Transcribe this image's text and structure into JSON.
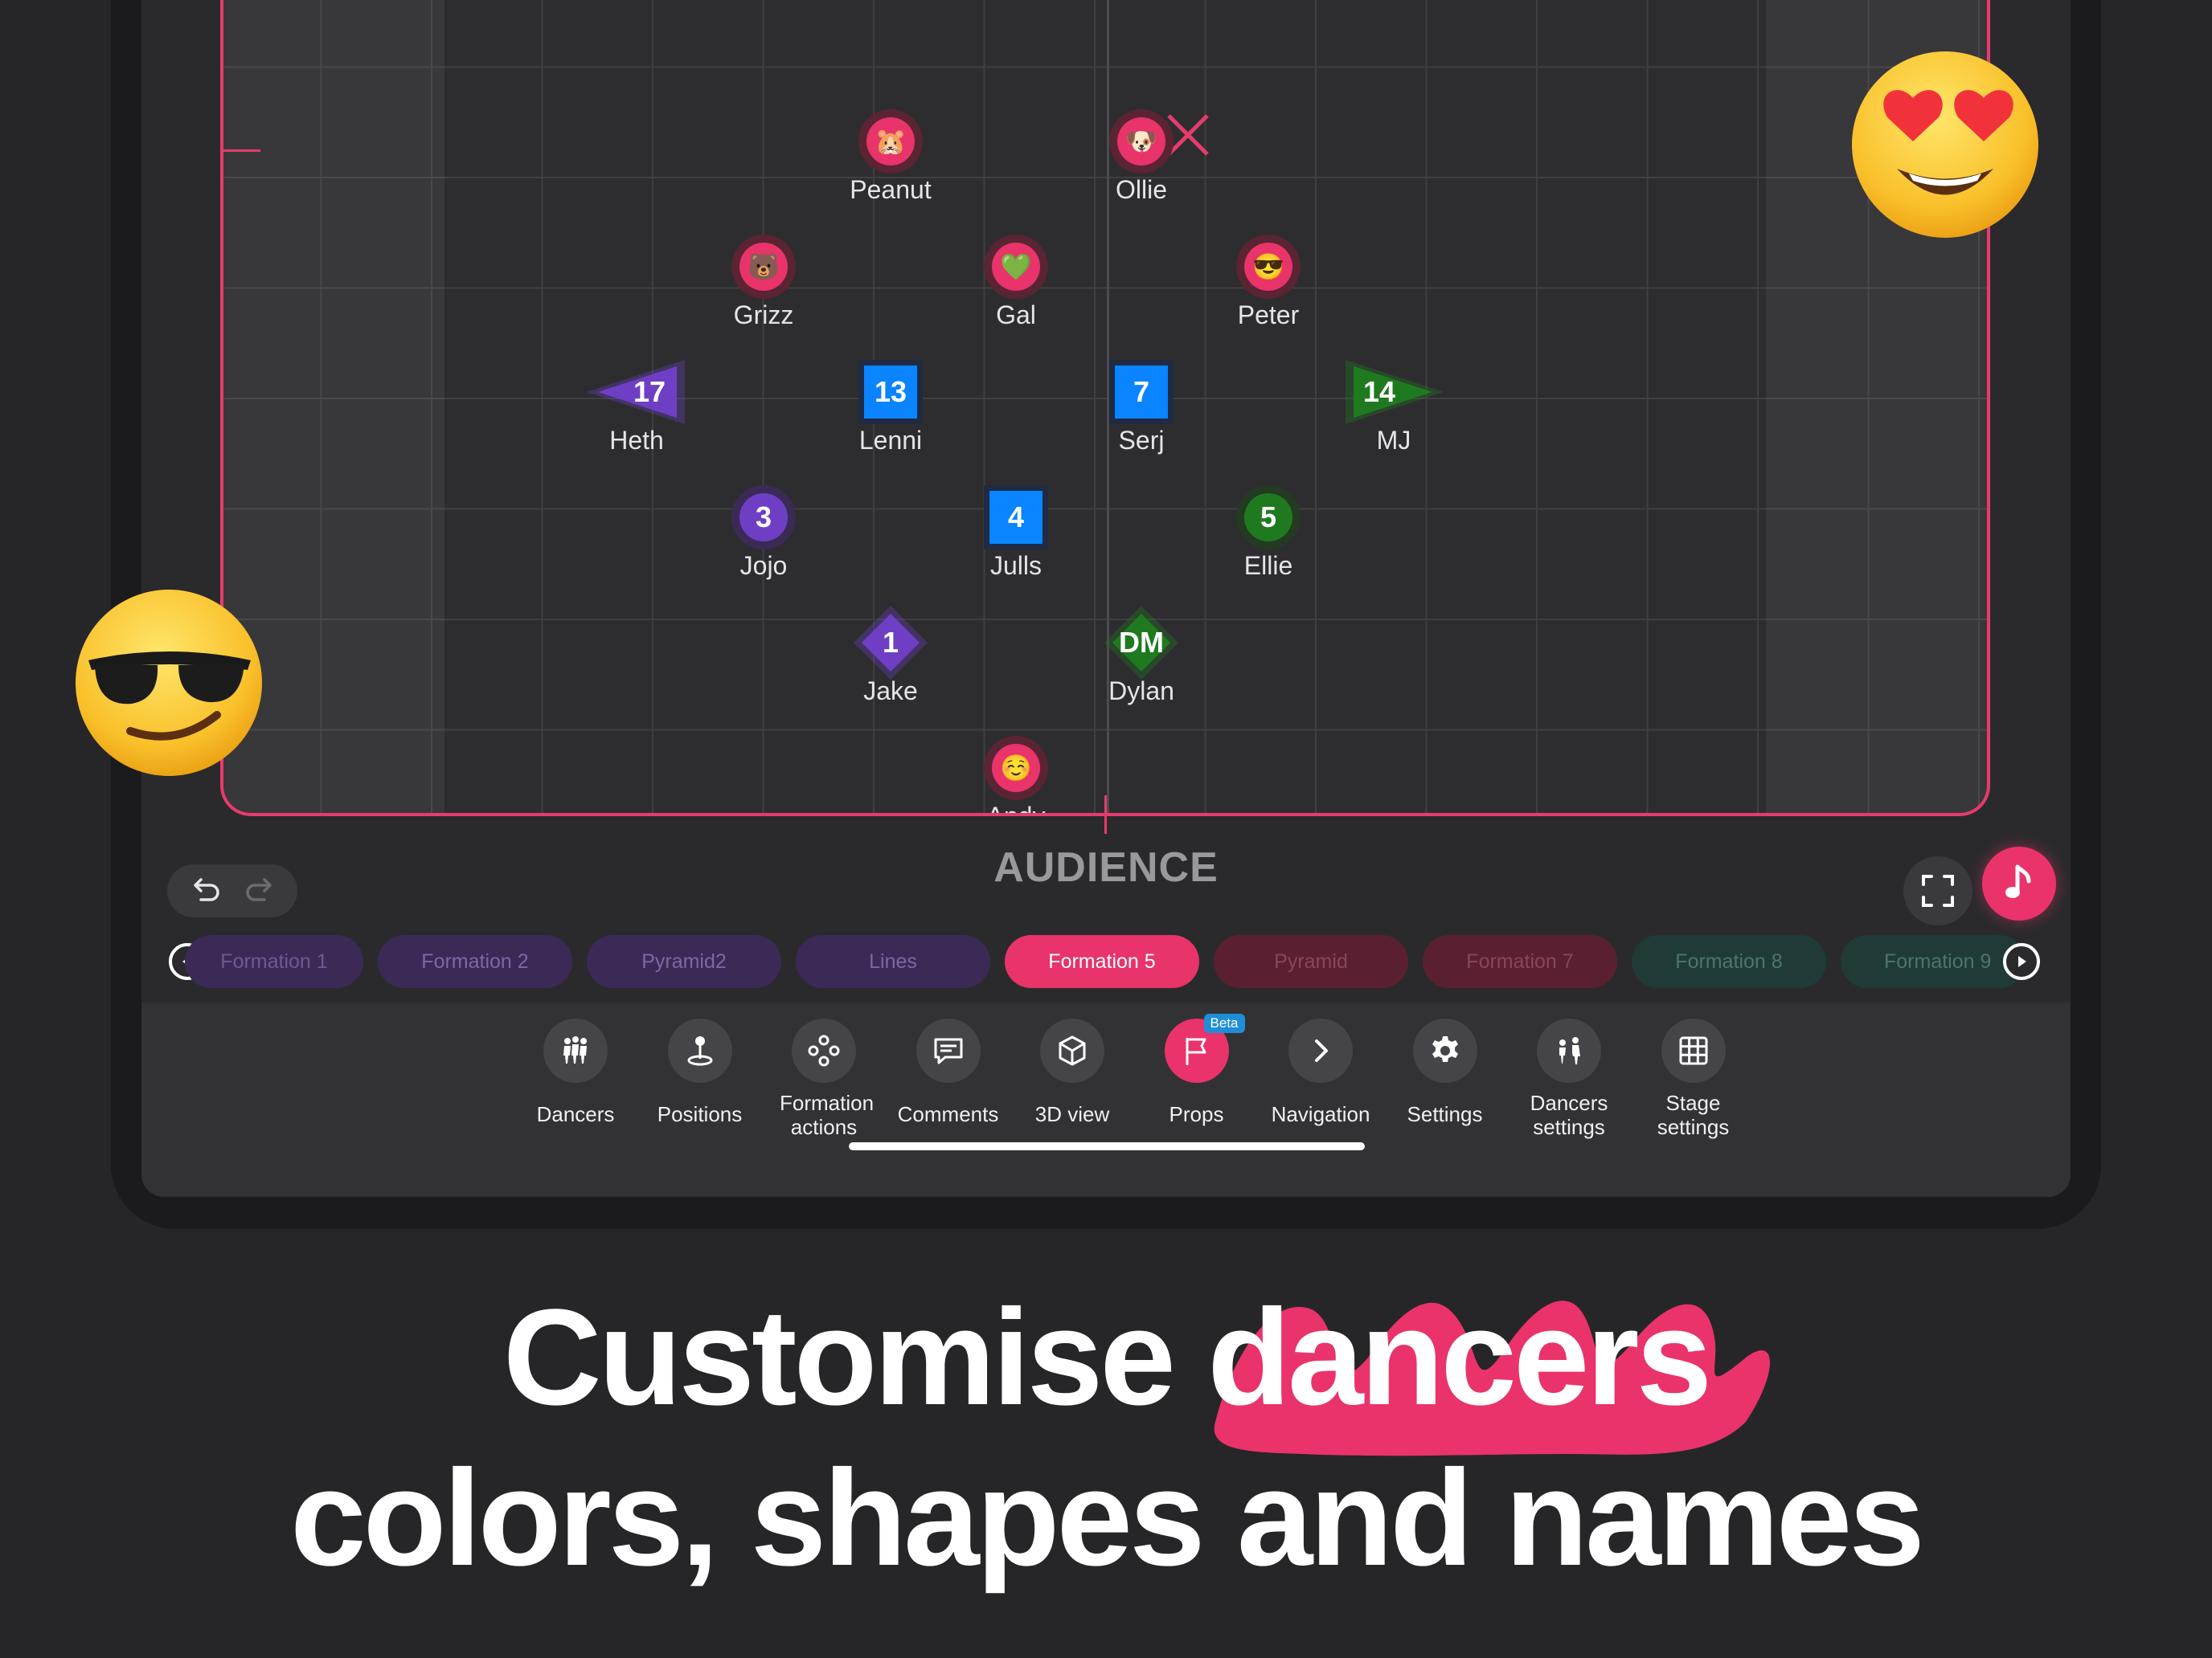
{
  "stage": {
    "audience_label": "AUDIENCE",
    "dancers": [
      {
        "name": "Peanut",
        "shape": "circle",
        "emoji": "🐹",
        "color": "#e8336b",
        "halo": "#5a2433"
      },
      {
        "name": "Ollie",
        "shape": "circle",
        "emoji": "🐶",
        "color": "#e8336b",
        "halo": "#5a2433"
      },
      {
        "name": "Grizz",
        "shape": "circle",
        "emoji": "🐻",
        "color": "#e8336b",
        "halo": "#5a2433"
      },
      {
        "name": "Gal",
        "shape": "circle",
        "emoji": "💚",
        "color": "#e8336b",
        "halo": "#5a2433"
      },
      {
        "name": "Peter",
        "shape": "circle",
        "emoji": "😎",
        "color": "#e8336b",
        "halo": "#5a2433"
      },
      {
        "name": "Heth",
        "shape": "triangle-left",
        "number": "17",
        "color": "#6e3fc4"
      },
      {
        "name": "Lenni",
        "shape": "square",
        "number": "13",
        "color": "#0a84ff"
      },
      {
        "name": "Serj",
        "shape": "square",
        "number": "7",
        "color": "#0a84ff"
      },
      {
        "name": "MJ",
        "shape": "triangle-right",
        "number": "14",
        "color": "#1f7a1f"
      },
      {
        "name": "Jojo",
        "shape": "circle",
        "number": "3",
        "color": "#6e3fc4",
        "halo": "#3b2a56"
      },
      {
        "name": "Julls",
        "shape": "square",
        "number": "4",
        "color": "#0a84ff"
      },
      {
        "name": "Ellie",
        "shape": "circle",
        "number": "5",
        "color": "#1f7a1f",
        "halo": "#233a23"
      },
      {
        "name": "Jake",
        "shape": "diamond",
        "number": "1",
        "color": "#6e3fc4"
      },
      {
        "name": "Dylan",
        "shape": "diamond",
        "number": "DM",
        "color": "#1f7a1f"
      },
      {
        "name": "Andy",
        "shape": "circle",
        "emoji": "☺️",
        "color": "#e8336b",
        "halo": "#5a2433"
      }
    ]
  },
  "formations": [
    {
      "label": "Formation 1",
      "bg": "#3a2a55",
      "fg": "#6f5a95",
      "active": false
    },
    {
      "label": "Formation 2",
      "bg": "#3a2a55",
      "fg": "#7d68a6",
      "active": false
    },
    {
      "label": "Pyramid2",
      "bg": "#3a2a55",
      "fg": "#7d68a6",
      "active": false
    },
    {
      "label": "Lines",
      "bg": "#3a2a55",
      "fg": "#7d68a6",
      "active": false
    },
    {
      "label": "Formation 5",
      "bg": "#e8336b",
      "fg": "#ffffff",
      "active": true
    },
    {
      "label": "Pyramid",
      "bg": "#5a2030",
      "fg": "#8c4558",
      "active": false
    },
    {
      "label": "Formation 7",
      "bg": "#5a2030",
      "fg": "#8c4558",
      "active": false
    },
    {
      "label": "Formation 8",
      "bg": "#1f3a37",
      "fg": "#4b7570",
      "active": false
    },
    {
      "label": "Formation 9",
      "bg": "#1f3a37",
      "fg": "#4b7570",
      "active": false
    }
  ],
  "toolbar": [
    {
      "label": "Dancers",
      "icon": "dancers-icon"
    },
    {
      "label": "Positions",
      "icon": "positions-icon"
    },
    {
      "label": "Formation actions",
      "icon": "formation-actions-icon"
    },
    {
      "label": "Comments",
      "icon": "comments-icon"
    },
    {
      "label": "3D view",
      "icon": "cube-icon"
    },
    {
      "label": "Props",
      "icon": "flag-icon",
      "badge": "Beta",
      "accent": "#ea336b"
    },
    {
      "label": "Navigation",
      "icon": "chevron-right-icon"
    },
    {
      "label": "Settings",
      "icon": "gear-icon"
    },
    {
      "label": "Dancers settings",
      "icon": "dancers-settings-icon"
    },
    {
      "label": "Stage settings",
      "icon": "grid-icon"
    }
  ],
  "headline": {
    "prefix": "Customise",
    "highlight": "dancers",
    "line2": "colors, shapes and names",
    "accent": "#ea336b"
  }
}
